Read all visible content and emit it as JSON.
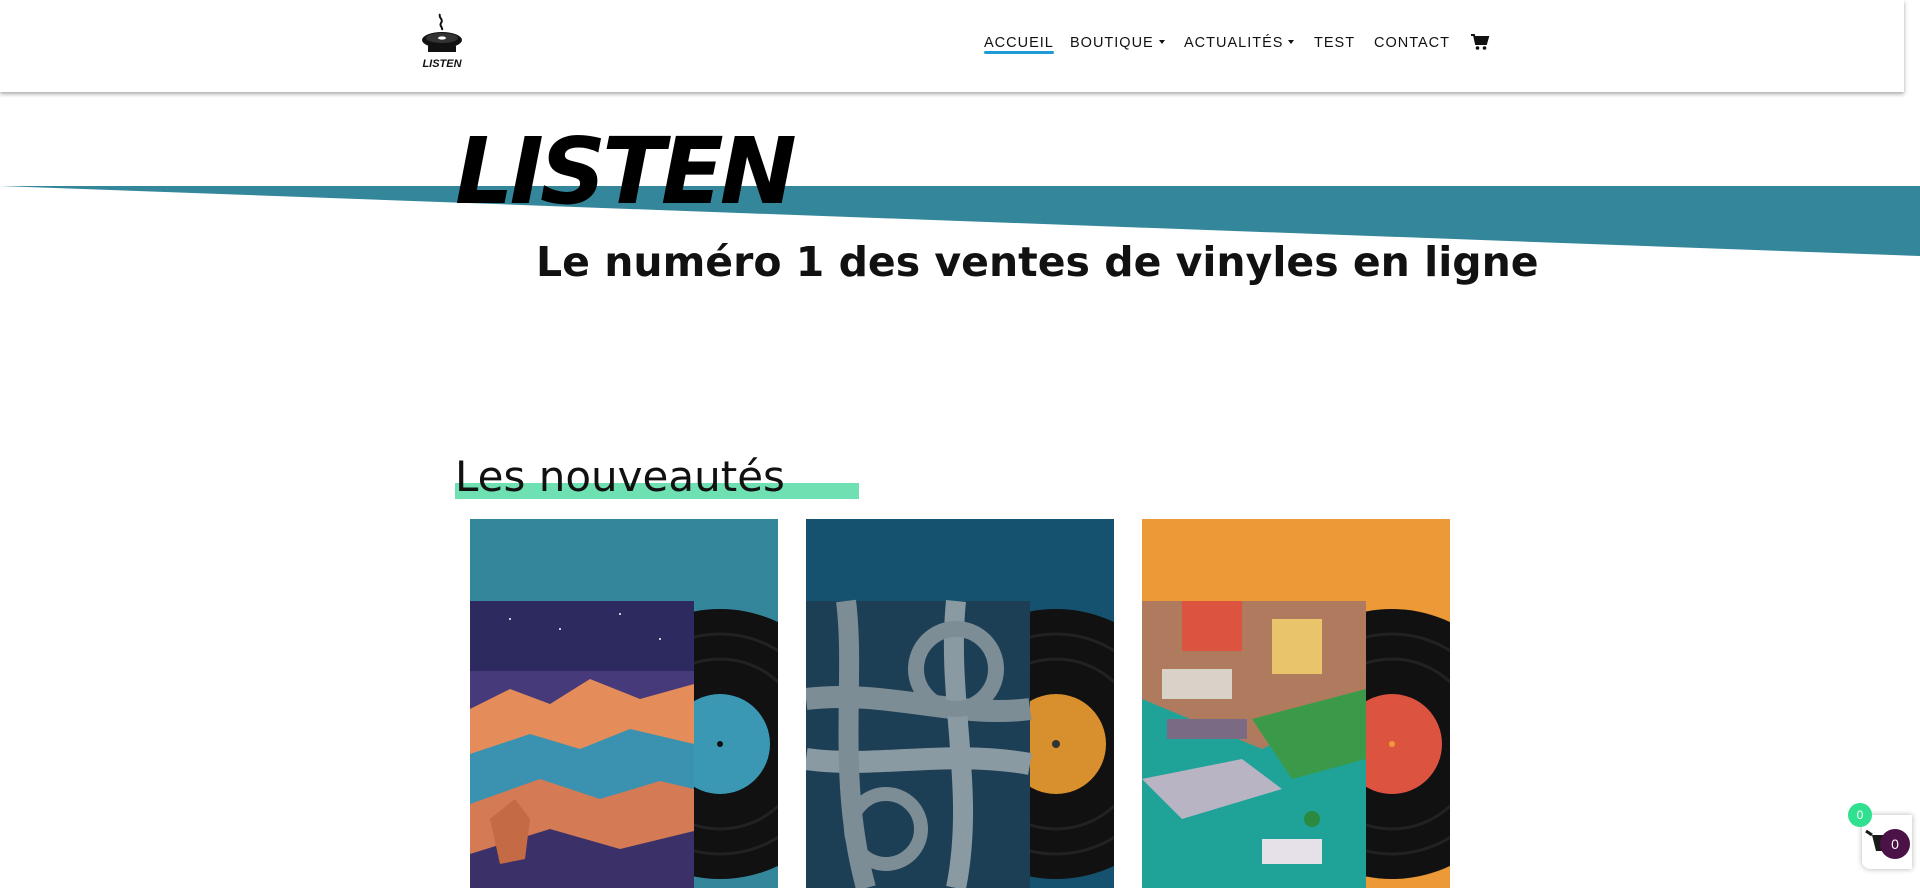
{
  "header": {
    "logo_text": "LISTEN",
    "nav": [
      {
        "label": "ACCUEIL",
        "active": true,
        "dropdown": false
      },
      {
        "label": "BOUTIQUE",
        "active": false,
        "dropdown": true
      },
      {
        "label": "ACTUALITÉS",
        "active": false,
        "dropdown": true
      },
      {
        "label": "TEST",
        "active": false,
        "dropdown": false
      },
      {
        "label": "CONTACT",
        "active": false,
        "dropdown": false
      }
    ],
    "cart_icon": "shopping-cart-icon"
  },
  "hero": {
    "title": "LISTEN",
    "subtitle": "Le numéro 1 des ventes de vinyles en ligne",
    "band_color": "#34869b"
  },
  "section": {
    "title": "Les nouveautés",
    "underline_color": "#6ee0b2"
  },
  "products": [
    {
      "background": "#34869b",
      "label_color": "#3b98b4",
      "art": "night-canyon-fox"
    },
    {
      "background": "#155270",
      "label_color": "#d8902f",
      "art": "highway-interchange"
    },
    {
      "background": "#eb9a37",
      "label_color": "#dc5340",
      "art": "isometric-harbor-city"
    }
  ],
  "floating_cart": {
    "count_top": "0",
    "count_bottom": "0",
    "icon": "basket-icon"
  },
  "colors": {
    "accent_blue": "#1e9bd7",
    "brand_teal": "#34869b",
    "mint": "#6ee0b2"
  }
}
